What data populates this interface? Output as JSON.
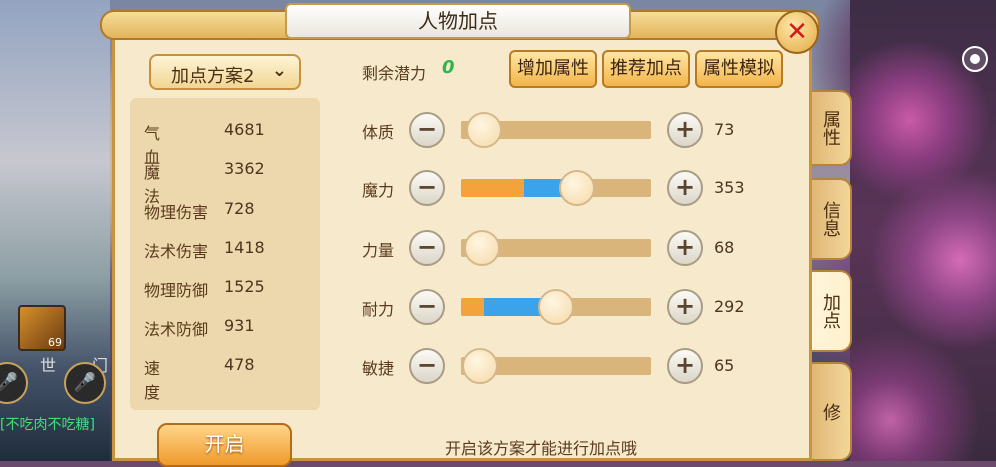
{
  "window": {
    "title": "人物加点"
  },
  "plan": {
    "selected": "加点方案2"
  },
  "stats": [
    {
      "name": "气血",
      "value": "4681"
    },
    {
      "name": "魔法",
      "value": "3362"
    },
    {
      "name": "物理伤害",
      "value": "728"
    },
    {
      "name": "法术伤害",
      "value": "1418"
    },
    {
      "name": "物理防御",
      "value": "1525"
    },
    {
      "name": "法术防御",
      "value": "931"
    },
    {
      "name": "速度",
      "value": "478"
    }
  ],
  "open_button": "开启",
  "potential": {
    "label": "剩余潜力",
    "value": "0"
  },
  "top_buttons": [
    "增加属性",
    "推荐加点",
    "属性模拟"
  ],
  "attributes": [
    {
      "name": "体质",
      "value": "73",
      "level": 0.12,
      "orange": 0.0,
      "blue": 0.0
    },
    {
      "name": "魔力",
      "value": "353",
      "level": 0.61,
      "orange": 0.33,
      "blue": 0.61
    },
    {
      "name": "力量",
      "value": "68",
      "level": 0.11,
      "orange": 0.0,
      "blue": 0.0
    },
    {
      "name": "耐力",
      "value": "292",
      "level": 0.5,
      "orange": 0.12,
      "blue": 0.5
    },
    {
      "name": "敏捷",
      "value": "65",
      "level": 0.1,
      "orange": 0.0,
      "blue": 0.0
    }
  ],
  "hint": "开启该方案才能进行加点哦",
  "side_tabs": [
    "属性",
    "信息",
    "加点",
    "修"
  ],
  "active_tab": "加点",
  "scene": {
    "world_label": "世",
    "sect_label": "门",
    "chat_text": "[不吃肉不吃糖]",
    "avatar_level": "69"
  },
  "colors": {
    "panel": "#f6e9cc",
    "border": "#c7933c",
    "potential_green": "#2bb84a",
    "close_red": "#d21c1c",
    "slider_orange": "#f3a23c",
    "slider_blue": "#3ba3ea"
  }
}
